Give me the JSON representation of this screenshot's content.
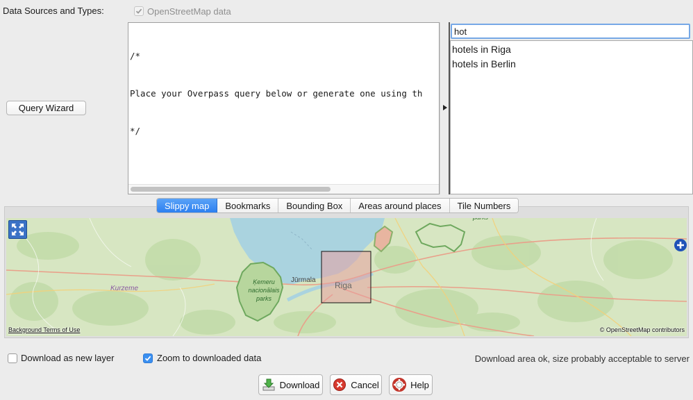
{
  "header": {
    "sources_label": "Data Sources and Types:",
    "osm_label": "OpenStreetMap data",
    "osm_checked": true
  },
  "query_wizard_label": "Query Wizard",
  "query_text": {
    "lines": [
      "/*",
      "Place your Overpass query below or generate one using th",
      "*/"
    ]
  },
  "search": {
    "value": "hot"
  },
  "history": {
    "items": [
      "hotels in Riga",
      "hotels in Berlin"
    ]
  },
  "tabs": [
    {
      "label": "Slippy map",
      "active": true
    },
    {
      "label": "Bookmarks",
      "active": false
    },
    {
      "label": "Bounding Box",
      "active": false
    },
    {
      "label": "Areas around places",
      "active": false
    },
    {
      "label": "Tile Numbers",
      "active": false
    }
  ],
  "map": {
    "place_labels": {
      "riga": "Riga",
      "jurmala": "Jūrmala",
      "kurzeme": "Kurzeme",
      "kemeru_1": "Ķemeru",
      "kemeru_2": "nacionālais",
      "kemeru_3": "parks",
      "top": "parks"
    },
    "attribution_left": "Background Terms of Use",
    "attribution_right": "© OpenStreetMap contributors",
    "colors": {
      "land": "#d7e6c2",
      "water": "#aad3df",
      "forest": "#c3dcaa",
      "selection": "#e8a0a0"
    }
  },
  "options": {
    "new_layer_label": "Download as new layer",
    "new_layer_checked": false,
    "zoom_label": "Zoom to downloaded data",
    "zoom_checked": true,
    "status": "Download area ok, size probably acceptable to server"
  },
  "buttons": {
    "download": "Download",
    "cancel": "Cancel",
    "help": "Help"
  }
}
